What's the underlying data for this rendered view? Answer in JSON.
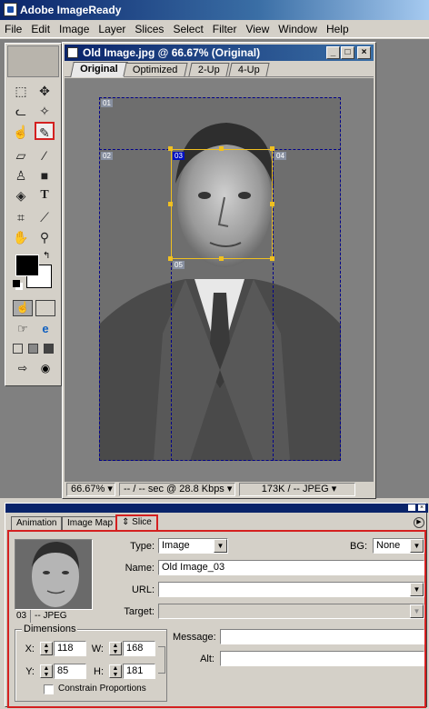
{
  "app": {
    "title": "Adobe ImageReady"
  },
  "menu": [
    "File",
    "Edit",
    "Image",
    "Layer",
    "Slices",
    "Select",
    "Filter",
    "View",
    "Window",
    "Help"
  ],
  "document": {
    "title": "Old Image.jpg @ 66.67% (Original)",
    "tabs": [
      "Original",
      "Optimized",
      "2-Up",
      "4-Up"
    ],
    "active_tab": "Original",
    "slice_labels": [
      "01",
      "02",
      "03",
      "04",
      "05"
    ],
    "selected_slice": "03",
    "status": {
      "zoom": "66.67%",
      "download": "-- / -- sec @ 28.8 Kbps",
      "size": "173K / -- JPEG"
    }
  },
  "toolbox": {
    "tools": [
      "marquee-icon",
      "move-icon",
      "lasso-icon",
      "magic-wand-icon",
      "slice-select-icon",
      "slice-icon",
      "eraser-icon",
      "paintbrush-icon",
      "stamp-icon",
      "rectangle-icon",
      "paint-bucket-icon",
      "type-icon",
      "crop-icon",
      "eyedropper-icon",
      "hand-icon",
      "zoom-icon"
    ],
    "selected_tool": "slice-select-icon",
    "foreground": "#000000",
    "background": "#ffffff"
  },
  "palette": {
    "tabs": [
      "Animation",
      "Image Map",
      "Slice"
    ],
    "active_tab": "Slice",
    "slice": {
      "type_label": "Type:",
      "type_value": "Image",
      "bg_label": "BG:",
      "bg_value": "None",
      "name_label": "Name:",
      "name_value": "Old Image_03",
      "url_label": "URL:",
      "url_value": "",
      "target_label": "Target:",
      "target_value": "",
      "thumb_caption_id": "03",
      "thumb_caption_fmt": "-- JPEG",
      "dimensions_label": "Dimensions",
      "x_label": "X:",
      "x": "118",
      "y_label": "Y:",
      "y": "85",
      "w_label": "W:",
      "w": "168",
      "h_label": "H:",
      "h": "181",
      "constrain_label": "Constrain Proportions",
      "message_label": "Message:",
      "message_value": "",
      "alt_label": "Alt:",
      "alt_value": ""
    }
  },
  "colors": {
    "titlebar": "#0a246a",
    "highlight": "#d42020",
    "slice_line": "#00008b",
    "slice_selected": "#f0c020"
  }
}
